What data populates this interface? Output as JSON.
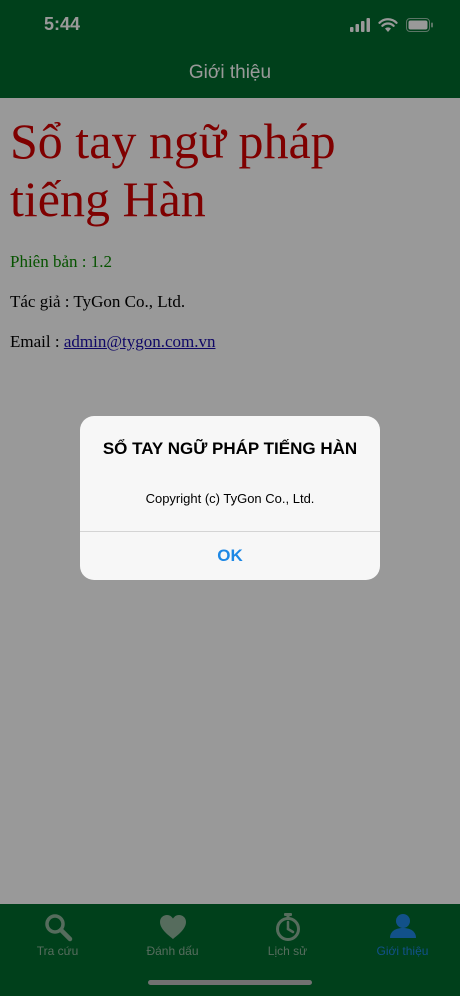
{
  "status_bar": {
    "time": "5:44",
    "icons": [
      "signal-icon",
      "wifi-icon",
      "battery-icon"
    ]
  },
  "nav": {
    "title": "Giới thiệu"
  },
  "content": {
    "app_title": "Sổ tay ngữ pháp tiếng Hàn",
    "version": "Phiên bản : 1.2",
    "author": "Tác giả : TyGon Co., Ltd.",
    "email_label": "Email : ",
    "email_link": "admin@tygon.com.vn"
  },
  "alert": {
    "title": "SỔ TAY NGỮ PHÁP TIẾNG HÀN",
    "message": "Copyright (c) TyGon Co., Ltd.",
    "ok_label": "OK"
  },
  "tabs": [
    {
      "label": "Tra cứu",
      "icon": "search-icon"
    },
    {
      "label": "Đánh dấu",
      "icon": "heart-icon"
    },
    {
      "label": "Lịch sử",
      "icon": "stopwatch-icon"
    },
    {
      "label": "Giới thiệu",
      "icon": "person-icon",
      "active": true
    }
  ],
  "colors": {
    "primary": "#006b2e",
    "title_red": "#d40000",
    "version_green": "#0b8a00",
    "link_blue": "#1a0dab",
    "accent_blue": "#1e88e5",
    "tab_inactive": "#8fb59b"
  }
}
